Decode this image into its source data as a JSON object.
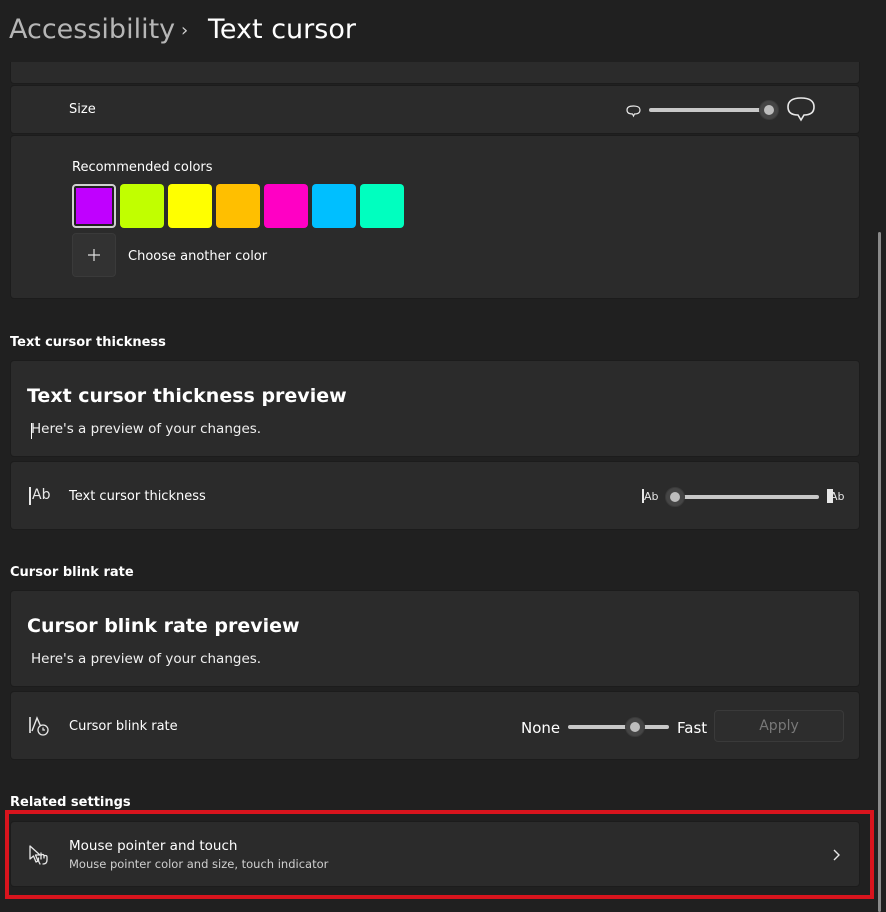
{
  "breadcrumb": {
    "parent": "Accessibility",
    "separator": "›",
    "current": "Text cursor"
  },
  "indicator": {
    "size_label": "Size",
    "size_value": 1.0,
    "recommended_colors_label": "Recommended colors",
    "colors": [
      "#c000ff",
      "#c1ff00",
      "#ffff00",
      "#ffbf00",
      "#ff00c4",
      "#00bfff",
      "#00ffbf"
    ],
    "selected_color_index": 0,
    "choose_color_label": "Choose another color"
  },
  "thickness": {
    "section_title": "Text cursor thickness",
    "preview_title": "Text cursor thickness preview",
    "preview_text": "Here's a preview of your changes.",
    "row_label": "Text cursor thickness",
    "slider_value": 0.0,
    "min_glyph": "Ab",
    "max_glyph": "Ab"
  },
  "blink": {
    "section_title": "Cursor blink rate",
    "preview_title": "Cursor blink rate preview",
    "preview_text": "Here's a preview of your changes.",
    "row_label": "Cursor blink rate",
    "min_label": "None",
    "max_label": "Fast",
    "slider_value": 0.66,
    "apply_label": "Apply"
  },
  "related": {
    "section_title": "Related settings",
    "item_title": "Mouse pointer and touch",
    "item_subtitle": "Mouse pointer color and size, touch indicator"
  },
  "colors": {
    "highlight": "#d8141d",
    "background": "#202020",
    "card": "#2b2b2b"
  }
}
